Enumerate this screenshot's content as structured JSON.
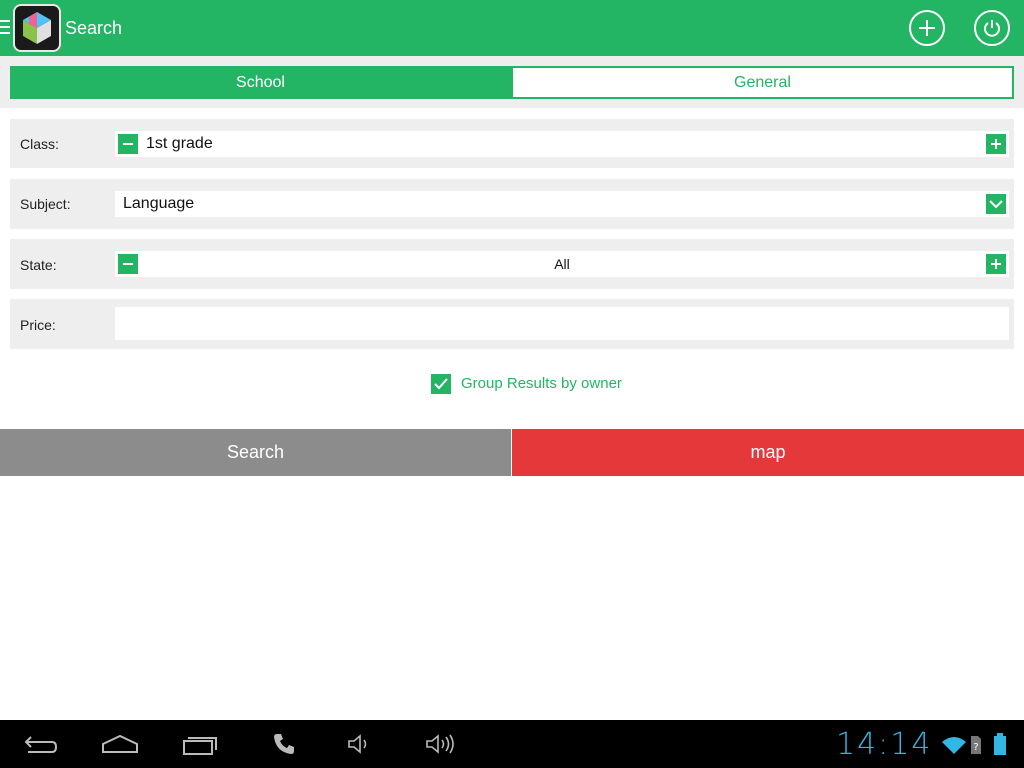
{
  "header": {
    "title": "Search",
    "icons": [
      "menu-icon",
      "app-logo-icon",
      "add-circle-icon",
      "power-icon"
    ]
  },
  "tabs": [
    {
      "label": "School",
      "selected": true
    },
    {
      "label": "General",
      "selected": false
    }
  ],
  "form": {
    "class": {
      "label": "Class:",
      "value": "1st grade"
    },
    "subject": {
      "label": "Subject:",
      "value": "Language"
    },
    "state": {
      "label": "State:",
      "value": "All"
    },
    "price": {
      "label": "Price:",
      "value": ""
    }
  },
  "group_results": {
    "label": "Group Results by owner",
    "checked": true
  },
  "buttons": {
    "search": "Search",
    "map": "map"
  },
  "system_bar": {
    "time": "14:14",
    "icons": [
      "back-icon",
      "home-icon",
      "recents-icon",
      "phone-icon",
      "volume-down-icon",
      "volume-up-icon",
      "wifi-icon",
      "sim-icon",
      "battery-icon"
    ]
  },
  "colors": {
    "primary": "#23b464",
    "map_button": "#e5383b",
    "search_button": "#8c8c8c",
    "clock": "#33b5e5"
  }
}
